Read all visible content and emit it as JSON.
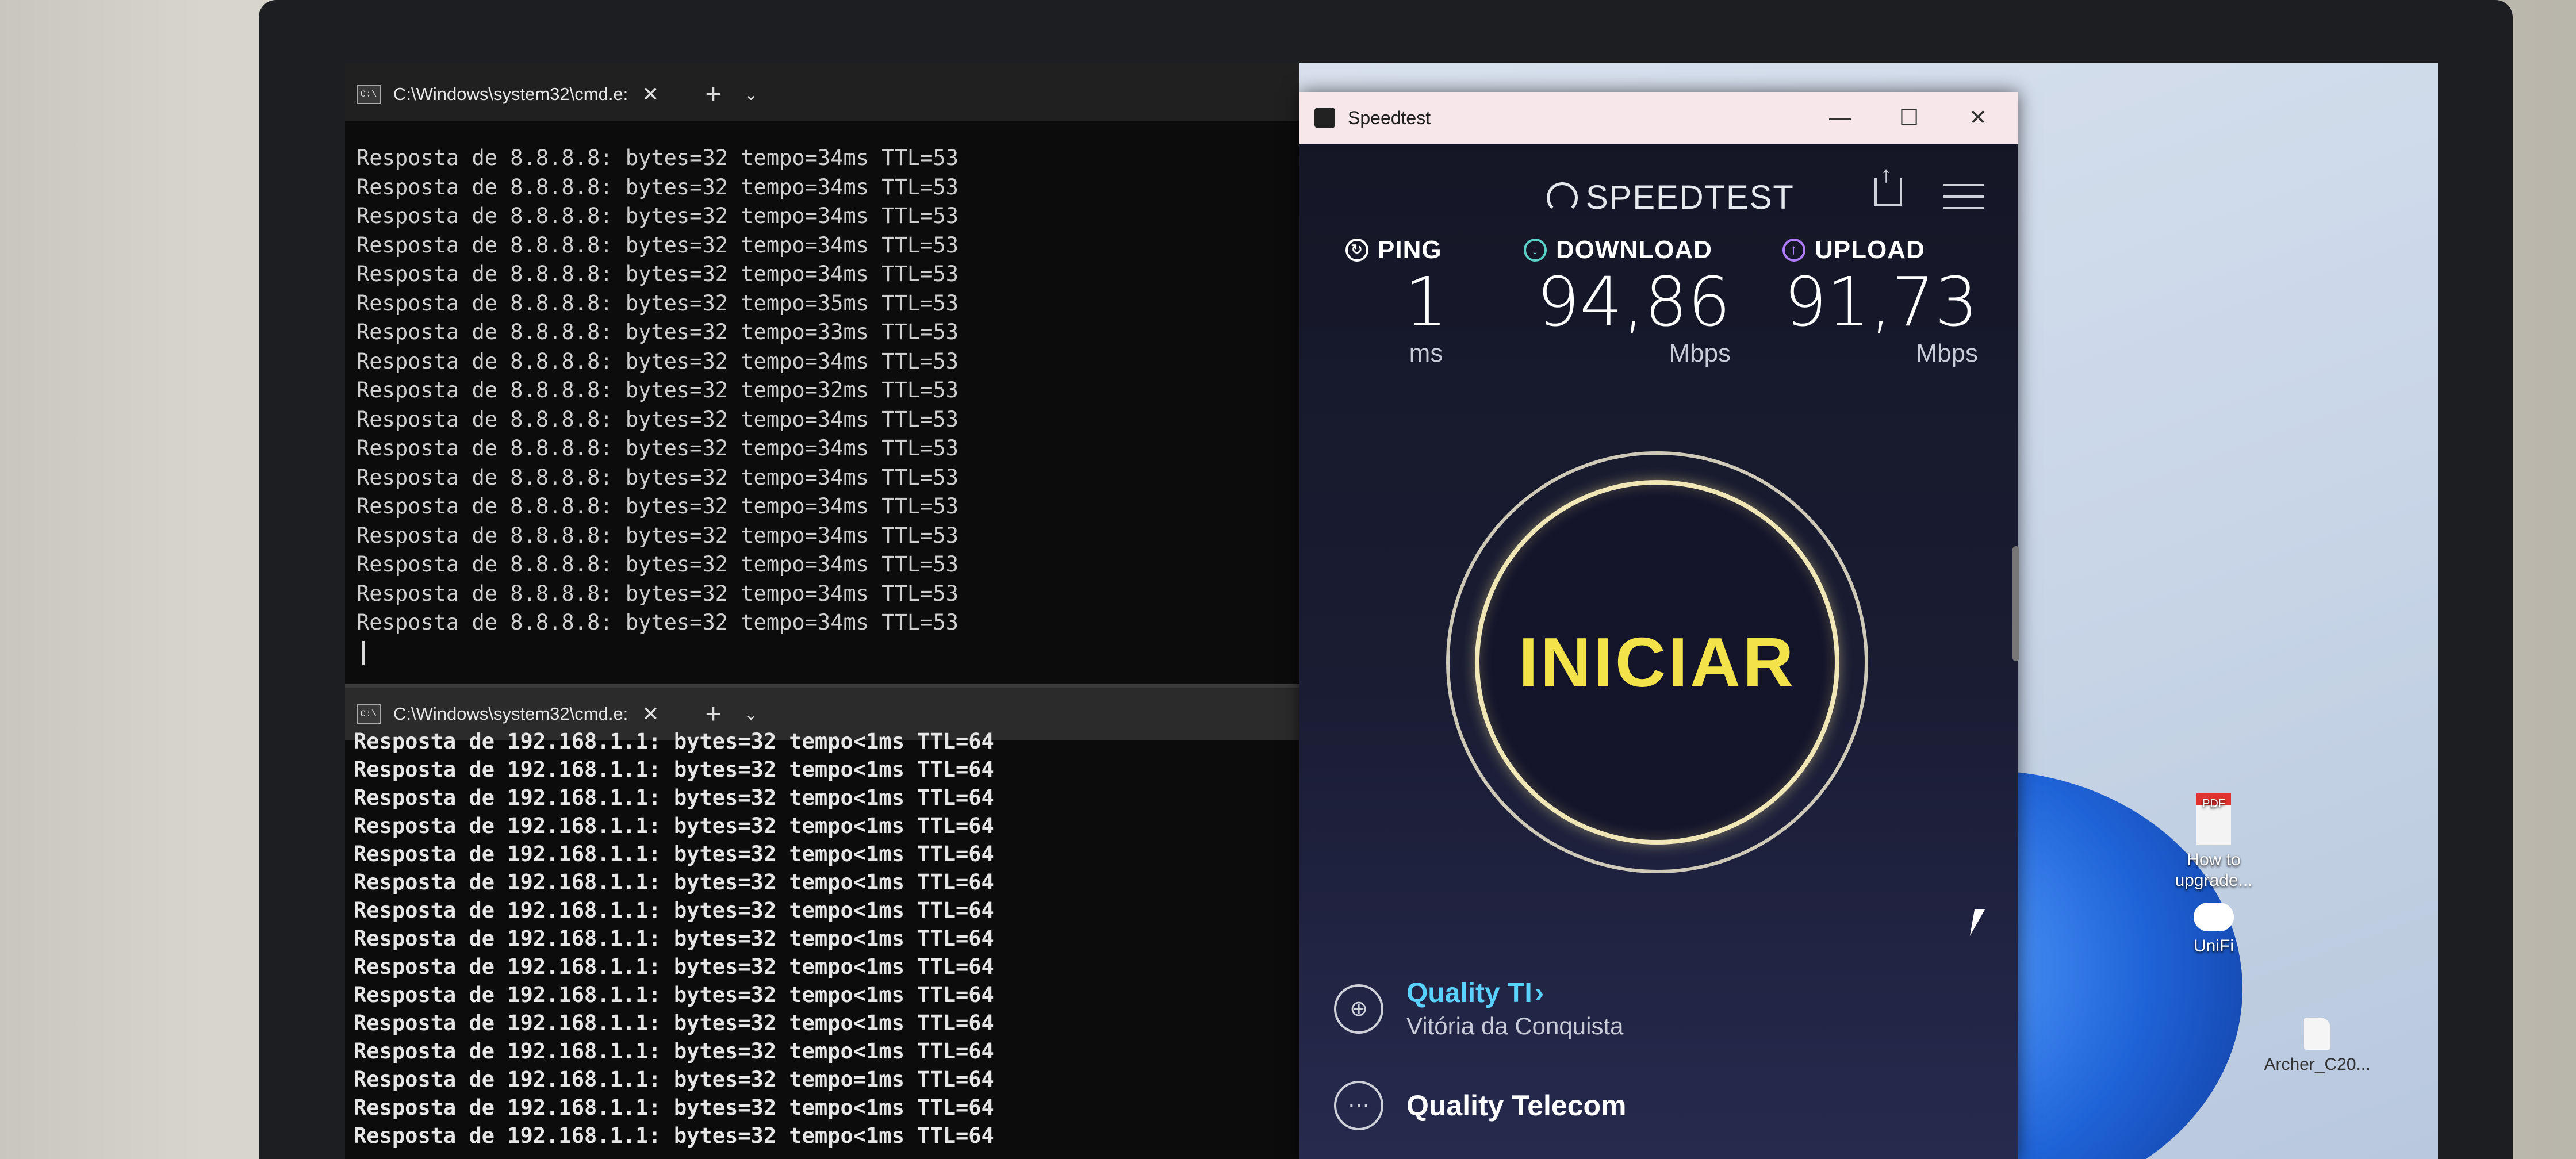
{
  "terminal_top": {
    "tab_title": "C:\\Windows\\system32\\cmd.e:",
    "icon_label": "C:\\",
    "close_symbol": "✕",
    "new_tab_symbol": "+",
    "dropdown_symbol": "⌄",
    "lines": [
      "Resposta de 8.8.8.8: bytes=32 tempo=34ms TTL=53",
      "Resposta de 8.8.8.8: bytes=32 tempo=34ms TTL=53",
      "Resposta de 8.8.8.8: bytes=32 tempo=34ms TTL=53",
      "Resposta de 8.8.8.8: bytes=32 tempo=34ms TTL=53",
      "Resposta de 8.8.8.8: bytes=32 tempo=34ms TTL=53",
      "Resposta de 8.8.8.8: bytes=32 tempo=35ms TTL=53",
      "Resposta de 8.8.8.8: bytes=32 tempo=33ms TTL=53",
      "Resposta de 8.8.8.8: bytes=32 tempo=34ms TTL=53",
      "Resposta de 8.8.8.8: bytes=32 tempo=32ms TTL=53",
      "Resposta de 8.8.8.8: bytes=32 tempo=34ms TTL=53",
      "Resposta de 8.8.8.8: bytes=32 tempo=34ms TTL=53",
      "Resposta de 8.8.8.8: bytes=32 tempo=34ms TTL=53",
      "Resposta de 8.8.8.8: bytes=32 tempo=34ms TTL=53",
      "Resposta de 8.8.8.8: bytes=32 tempo=34ms TTL=53",
      "Resposta de 8.8.8.8: bytes=32 tempo=34ms TTL=53",
      "Resposta de 8.8.8.8: bytes=32 tempo=34ms TTL=53",
      "Resposta de 8.8.8.8: bytes=32 tempo=34ms TTL=53"
    ]
  },
  "terminal_bottom": {
    "tab_title": "C:\\Windows\\system32\\cmd.e:",
    "icon_label": "C:\\",
    "close_symbol": "✕",
    "new_tab_symbol": "+",
    "dropdown_symbol": "⌄",
    "lines": [
      "Resposta de 192.168.1.1: bytes=32 tempo<1ms TTL=64",
      "Resposta de 192.168.1.1: bytes=32 tempo<1ms TTL=64",
      "Resposta de 192.168.1.1: bytes=32 tempo<1ms TTL=64",
      "Resposta de 192.168.1.1: bytes=32 tempo<1ms TTL=64",
      "Resposta de 192.168.1.1: bytes=32 tempo<1ms TTL=64",
      "Resposta de 192.168.1.1: bytes=32 tempo<1ms TTL=64",
      "Resposta de 192.168.1.1: bytes=32 tempo<1ms TTL=64",
      "Resposta de 192.168.1.1: bytes=32 tempo<1ms TTL=64",
      "Resposta de 192.168.1.1: bytes=32 tempo<1ms TTL=64",
      "Resposta de 192.168.1.1: bytes=32 tempo<1ms TTL=64",
      "Resposta de 192.168.1.1: bytes=32 tempo<1ms TTL=64",
      "Resposta de 192.168.1.1: bytes=32 tempo<1ms TTL=64",
      "Resposta de 192.168.1.1: bytes=32 tempo=1ms TTL=64",
      "Resposta de 192.168.1.1: bytes=32 tempo<1ms TTL=64",
      "Resposta de 192.168.1.1: bytes=32 tempo<1ms TTL=64"
    ]
  },
  "speedtest": {
    "window_title": "Speedtest",
    "minimize": "—",
    "maximize": "☐",
    "close": "✕",
    "brand": "SPEEDTEST",
    "ping": {
      "label": "PING",
      "value": "1",
      "unit": "ms",
      "icon": "ping-icon",
      "color": "#ffffff"
    },
    "download": {
      "label": "DOWNLOAD",
      "value": "94,86",
      "unit": "Mbps",
      "icon": "download-arrow-icon",
      "color": "#5ad2c8"
    },
    "upload": {
      "label": "UPLOAD",
      "value": "91,73",
      "unit": "Mbps",
      "icon": "upload-arrow-icon",
      "color": "#b07cff"
    },
    "start_label": "INICIAR",
    "start_color": "#f3e24a",
    "isp_name": "Quality TI",
    "isp_chevron": "›",
    "isp_city": "Vitória da Conquista",
    "server_name": "Quality Telecom"
  },
  "desktop": {
    "icons": [
      {
        "label": "How to upgrade...",
        "icon": "pdf-file-icon"
      },
      {
        "label": "UniFi",
        "icon": "unifi-cloud-icon"
      },
      {
        "label": "Archer_C20...",
        "icon": "file-icon"
      }
    ],
    "pdf_badge": "PDF"
  }
}
